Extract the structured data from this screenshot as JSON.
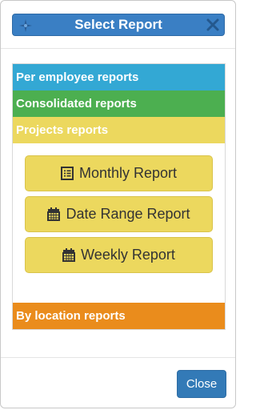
{
  "dialog": {
    "title": "Select Report",
    "close_label": "Close"
  },
  "accordion": {
    "sections": [
      {
        "label": "Per employee reports",
        "color": "#33a8d4"
      },
      {
        "label": "Consolidated reports",
        "color": "#4caf50"
      },
      {
        "label": "Projects reports",
        "color": "#ecd85e"
      },
      {
        "label": "By location reports",
        "color": "#ea8c1c"
      }
    ],
    "project_reports": [
      {
        "label": "Monthly Report",
        "icon": "list-icon"
      },
      {
        "label": "Date Range Report",
        "icon": "calendar-icon"
      },
      {
        "label": "Weekly Report",
        "icon": "calendar-icon"
      }
    ]
  },
  "colors": {
    "title_bar": "#3a7fc4",
    "primary_button": "#337ab7"
  }
}
